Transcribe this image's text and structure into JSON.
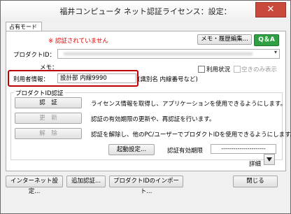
{
  "window": {
    "title": "福井コンピュータ ネット認証ライセンス：設定：",
    "close_glyph": "✕"
  },
  "tabs": [
    {
      "label": "占有モード",
      "active": true
    }
  ],
  "status": {
    "message": "※ 認証されていません",
    "color": "#e00000"
  },
  "buttons": {
    "memo_history": "メモ・履歴編集...",
    "qa": "Q＆A",
    "authenticate": "認　証",
    "update": "更　新",
    "release": "解　除",
    "activation_settings": "起動設定...",
    "internet_settings": "インターネット設定...",
    "add_auth": "追加認証...",
    "import_product_id": "プロダクトIDのインポート...",
    "close": "閉じる"
  },
  "form": {
    "product_id_label": "プロダクトID：",
    "product_id_value": "",
    "memo_label": "メモ：",
    "usage_status_label": "利用状況",
    "available_only_label": "空きのみ表示",
    "user_info_label": "利用者情報：",
    "user_info_value": "設計部 内線9990",
    "user_info_hint": "(識別名 内線番号など)"
  },
  "group": {
    "title": "プロダクトID認証",
    "auth_desc": "ライセンス情報を取得し、アプリケーションを使用できるようにします。",
    "update_desc": "認証の有効期限の更新や、再認証を行います。",
    "release_desc": "認証を解除し、他のPC/ユーザーでプロダクトIDを使用できるようにします。",
    "expiry_label": "認証有効期限",
    "expiry_value": "----------------------"
  },
  "details_label": "詳細",
  "colors": {
    "accent_red": "#c00000",
    "qa_green": "#2ea043",
    "titlebar_close": "#c94a3c"
  }
}
